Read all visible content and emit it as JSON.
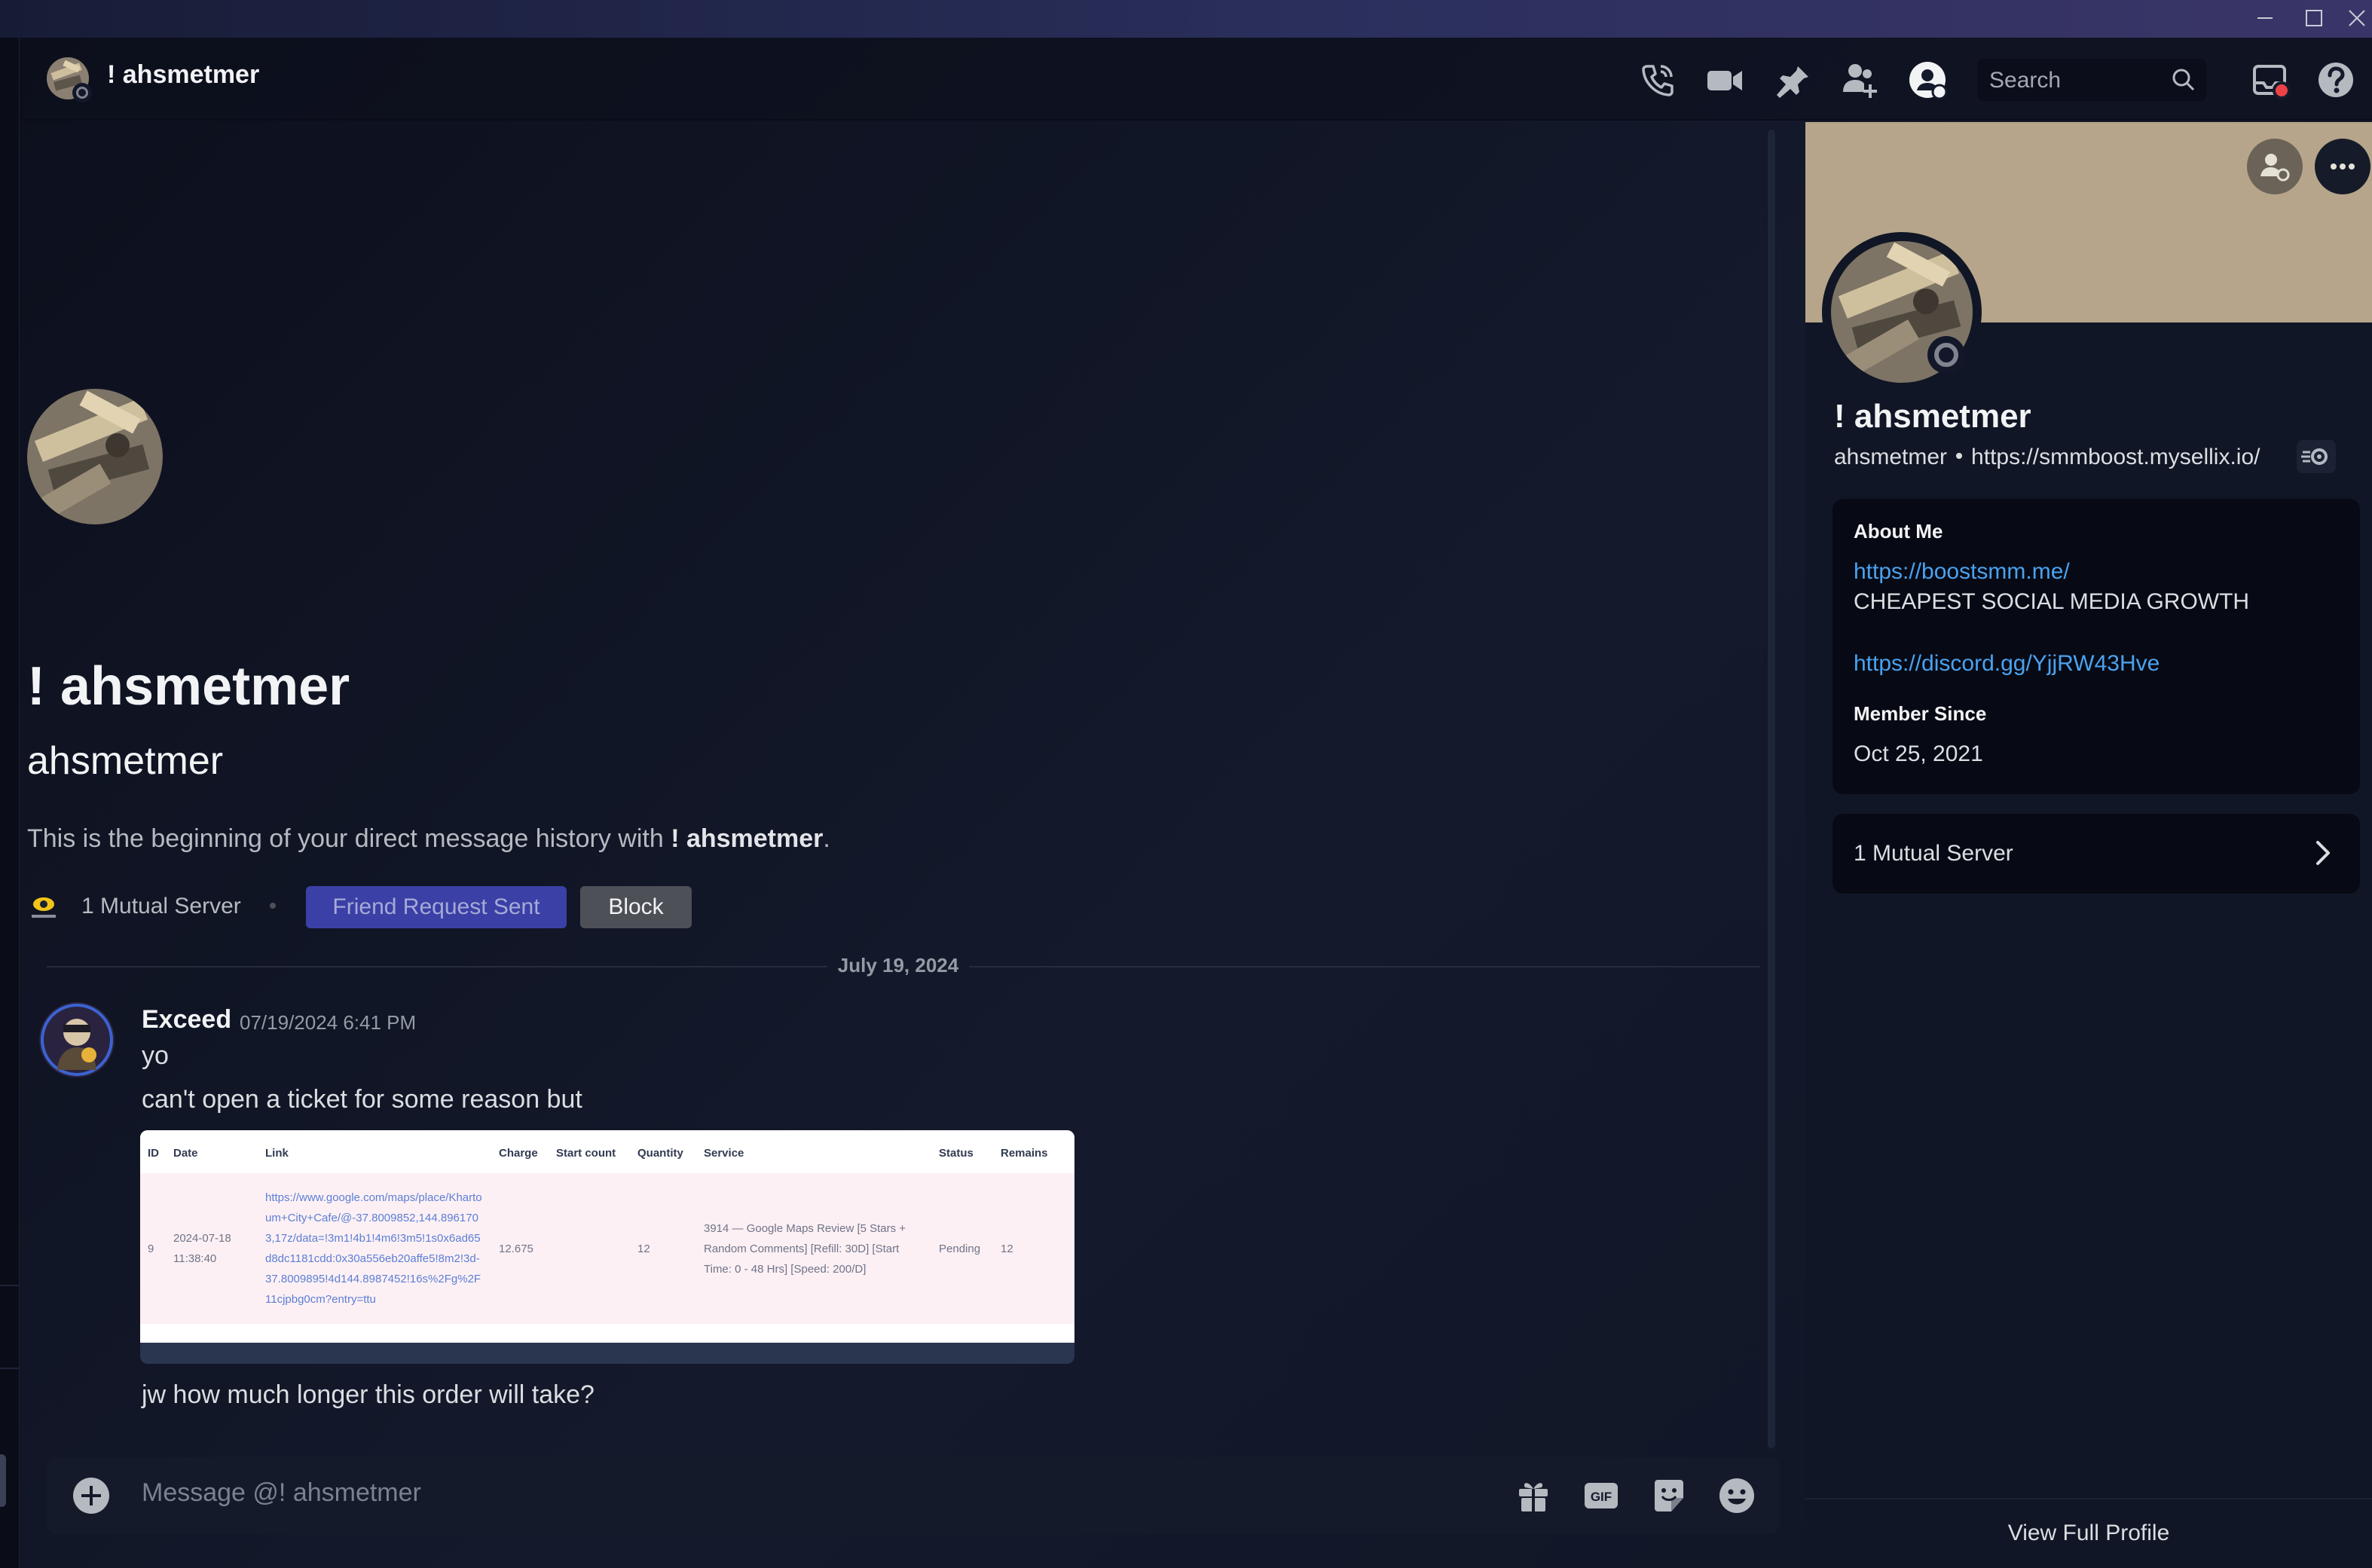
{
  "header": {
    "display_name": "! ahsmetmer",
    "search_placeholder": "Search"
  },
  "intro": {
    "display_name": "! ahsmetmer",
    "username": "ahsmetmer",
    "beginning_text": "This is the beginning of your direct message history with ",
    "beginning_name": "! ahsmetmer",
    "beginning_end": ".",
    "mutual_server": "1 Mutual Server",
    "friend_request_button": "Friend Request Sent",
    "block_button": "Block"
  },
  "date_divider": "July 19, 2024",
  "message": {
    "author": "Exceed",
    "timestamp": "07/19/2024 6:41 PM",
    "lines": [
      "yo",
      "can't open a ticket for some reason but",
      "jw how much longer this order will take?"
    ],
    "attachment": {
      "headers": [
        "ID",
        "Date",
        "Link",
        "Charge",
        "Start count",
        "Quantity",
        "Service",
        "Status",
        "Remains"
      ],
      "row": {
        "id": "9",
        "date": "2024-07-18 11:38:40",
        "link": "https://www.google.com/maps/place/Khartoum+City+Cafe/@-37.8009852,144.8961703,17z/data=!3m1!4b1!4m6!3m5!1s0x6ad65d8dc1181cdd:0x30a556eb20affe5!8m2!3d-37.8009895!4d144.8987452!16s%2Fg%2F11cjpbg0cm?entry=ttu",
        "charge": "12.675",
        "start_count": "",
        "quantity": "12",
        "service": "3914 — Google Maps Review [5 Stars + Random Comments] [Refill: 30D] [Start Time: 0 - 48 Hrs] [Speed: 200/D]",
        "status": "Pending",
        "remains": "12"
      }
    }
  },
  "composer": {
    "placeholder": "Message @! ahsmetmer",
    "icons": [
      "gift-icon",
      "gif-icon",
      "sticker-icon",
      "emoji-icon"
    ],
    "gif_label": "GIF"
  },
  "profile": {
    "display_name": "! ahsmetmer",
    "username": "ahsmetmer",
    "pronouns_link": "https://smmboost.mysellix.io/",
    "about_title": "About Me",
    "about_link1": "https://boostsmm.me/",
    "about_text": "CHEAPEST SOCIAL MEDIA GROWTH",
    "about_link2": "https://discord.gg/YjjRW43Hve",
    "member_since_title": "Member Since",
    "member_since": "Oct 25, 2021",
    "mutual_servers": "1 Mutual Server",
    "view_full_profile": "View Full Profile"
  },
  "colors": {
    "accent_link": "#4aa2f0",
    "friend_button": "#3b40a6",
    "block_button": "#4e5058",
    "banner": "#b6a58a",
    "notification_dot": "#ed4245"
  }
}
